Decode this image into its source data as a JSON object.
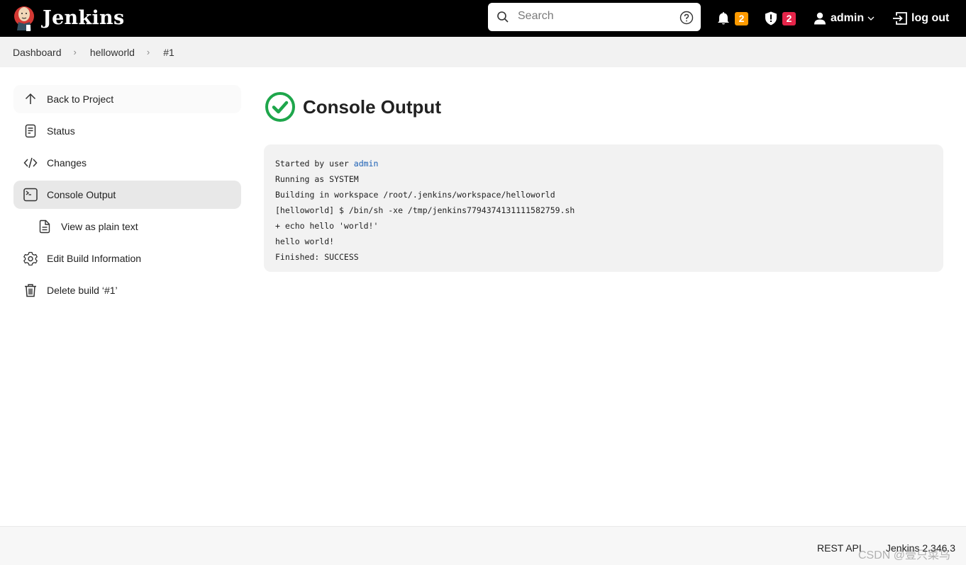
{
  "header": {
    "app_name": "Jenkins",
    "search_placeholder": "Search",
    "notifications_count": "2",
    "security_count": "2",
    "user": "admin",
    "logout_label": "log out",
    "colors": {
      "notification_badge": "#fe9a00",
      "security_badge": "#e6254a"
    }
  },
  "breadcrumb": [
    {
      "label": "Dashboard"
    },
    {
      "label": "helloworld"
    },
    {
      "label": "#1"
    }
  ],
  "sidebar": {
    "items": [
      {
        "label": "Back to Project",
        "icon": "arrow-up-icon"
      },
      {
        "label": "Status",
        "icon": "document-icon"
      },
      {
        "label": "Changes",
        "icon": "code-icon"
      },
      {
        "label": "Console Output",
        "icon": "terminal-icon",
        "active": true
      },
      {
        "label": "View as plain text",
        "icon": "file-text-icon"
      },
      {
        "label": "Edit Build Information",
        "icon": "gear-icon"
      },
      {
        "label": "Delete build ‘#1’",
        "icon": "trash-icon"
      }
    ]
  },
  "main": {
    "title": "Console Output",
    "status": "success",
    "status_color": "#1ea64b",
    "console": {
      "started_prefix": "Started by user ",
      "started_user": "admin",
      "lines": [
        "Running as SYSTEM",
        "Building in workspace /root/.jenkins/workspace/helloworld",
        "[helloworld] $ /bin/sh -xe /tmp/jenkins7794374131111582759.sh",
        "+ echo hello 'world!'",
        "hello world!",
        "Finished: SUCCESS"
      ]
    }
  },
  "footer": {
    "rest_api": "REST API",
    "version": "Jenkins 2.346.3"
  },
  "watermark": "CSDN @壹只菜鸟"
}
